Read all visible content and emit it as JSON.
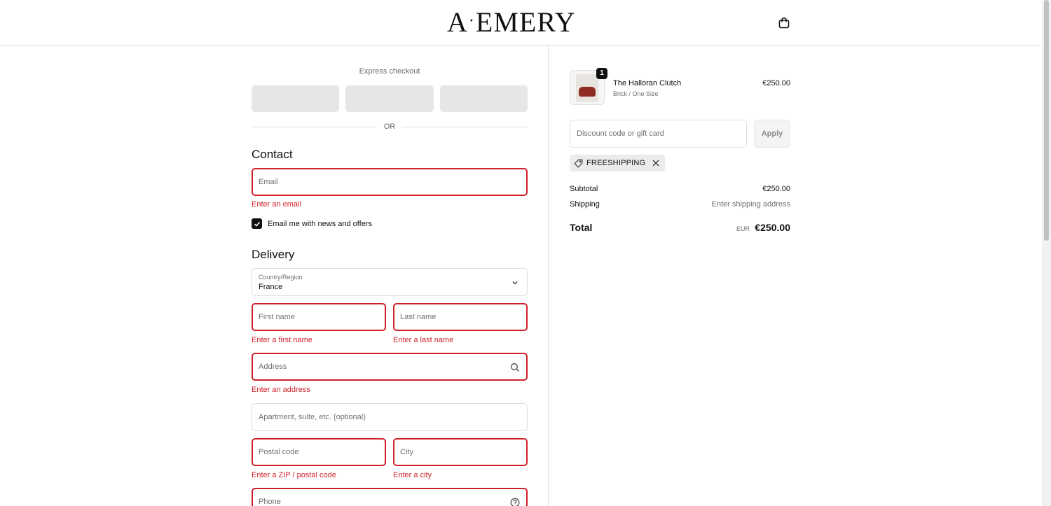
{
  "header": {
    "logo_part1": "A",
    "logo_dot": "·",
    "logo_part2": "EMERY",
    "cart_icon": "shopping-bag-icon"
  },
  "express": {
    "label": "Express checkout",
    "separator": "OR"
  },
  "contact": {
    "title": "Contact",
    "email_placeholder": "Email",
    "email_error": "Enter an email",
    "newsletter_label": "Email me with news and offers",
    "newsletter_checked": true
  },
  "delivery": {
    "title": "Delivery",
    "country_label": "Country/Region",
    "country_value": "France",
    "first_name_placeholder": "First name",
    "first_name_error": "Enter a first name",
    "last_name_placeholder": "Last name",
    "last_name_error": "Enter a last name",
    "address_placeholder": "Address",
    "address_error": "Enter an address",
    "apartment_placeholder": "Apartment, suite, etc. (optional)",
    "postal_placeholder": "Postal code",
    "postal_error": "Enter a ZIP / postal code",
    "city_placeholder": "City",
    "city_error": "Enter a city",
    "phone_placeholder": "Phone"
  },
  "summary": {
    "product": {
      "name": "The Halloran Clutch",
      "variant": "Brick / One Size",
      "price": "€250.00",
      "quantity": "1"
    },
    "discount_placeholder": "Discount code or gift card",
    "apply_label": "Apply",
    "applied_code": "FREESHIPPING",
    "subtotal_label": "Subtotal",
    "subtotal_value": "€250.00",
    "shipping_label": "Shipping",
    "shipping_value": "Enter shipping address",
    "total_label": "Total",
    "total_currency": "EUR",
    "total_value": "€250.00"
  },
  "colors": {
    "error": "#d0212b",
    "border": "#dedede",
    "express_button": "#e6e6e6"
  }
}
